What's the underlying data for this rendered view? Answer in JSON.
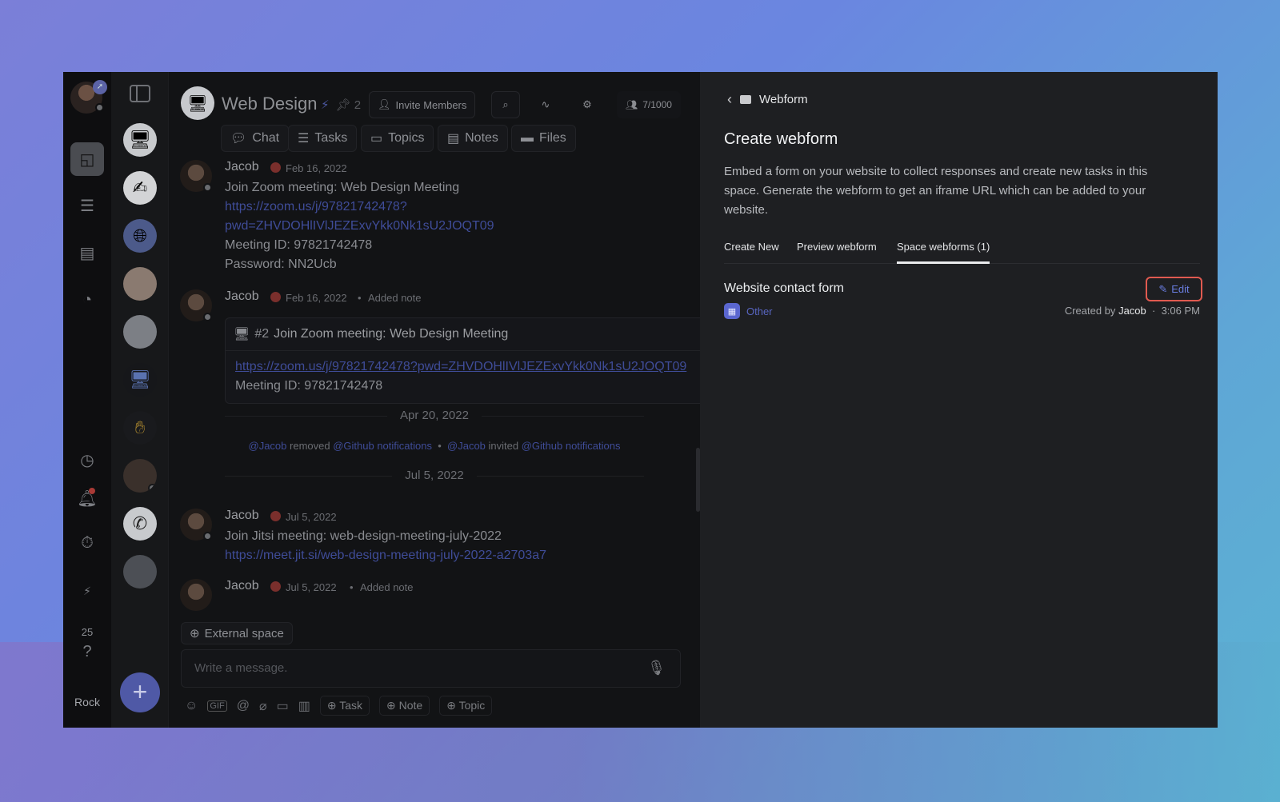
{
  "rail": {
    "count": "25",
    "user_label": "Rock"
  },
  "space": {
    "title": "Web Design",
    "pins": "2",
    "invite_label": "Invite Members",
    "members": "7/1000",
    "tabs": [
      "Chat",
      "Tasks",
      "Topics",
      "Notes",
      "Files"
    ]
  },
  "messages": {
    "m1": {
      "author": "Jacob",
      "date": "Feb 16, 2022",
      "lines": [
        "Join Zoom meeting: Web Design Meeting",
        "https://zoom.us/j/97821742478?",
        "pwd=ZHVDOHlIVlJEZExvYkk0Nk1sU2JOQT09",
        "Meeting ID: 97821742478",
        "Password: NN2Ucb"
      ]
    },
    "m2": {
      "author": "Jacob",
      "date": "Feb 16, 2022",
      "action": "Added note",
      "note_num": "#2",
      "note_title": "Join Zoom meeting: Web Design Meeting",
      "note_link": "https://zoom.us/j/97821742478?pwd=ZHVDOHlIVlJEZExvYkk0Nk1sU2JOQT09",
      "note_meta": "Meeting ID: 97821742478"
    },
    "divider1": "Apr 20, 2022",
    "system": {
      "u1": "@Jacob",
      "t1": "removed",
      "u2": "@Github notifications",
      "u3": "@Jacob",
      "t2": "invited",
      "u4": "@Github notifications"
    },
    "divider2": "Jul 5, 2022",
    "m3": {
      "author": "Jacob",
      "date": "Jul 5, 2022",
      "lines": [
        "Join Jitsi meeting: web-design-meeting-july-2022",
        "https://meet.jit.si/web-design-meeting-july-2022-a2703a7"
      ]
    },
    "m4": {
      "author": "Jacob",
      "date": "Jul 5, 2022",
      "action": "Added note"
    }
  },
  "composer": {
    "external_label": "External space",
    "placeholder": "Write a message.",
    "task_btn": "Task",
    "note_btn": "Note",
    "topic_btn": "Topic"
  },
  "panel": {
    "breadcrumb": "Webform",
    "title": "Create webform",
    "description": "Embed a form on your website to collect responses and create new tasks in this space. Generate the webform to get an iframe URL which can be added to your website.",
    "tabs": [
      "Create New",
      "Preview webform",
      "Space webforms (1)"
    ],
    "active_tab": "Space webforms (1)",
    "form": {
      "name": "Website contact form",
      "tag": "Other",
      "edit_label": "Edit",
      "created_prefix": "Created by",
      "created_by": "Jacob",
      "time": "3:06 PM"
    }
  },
  "colors": {
    "accent": "#5865c0",
    "highlight": "#e05a50",
    "link": "#3f4c98"
  }
}
